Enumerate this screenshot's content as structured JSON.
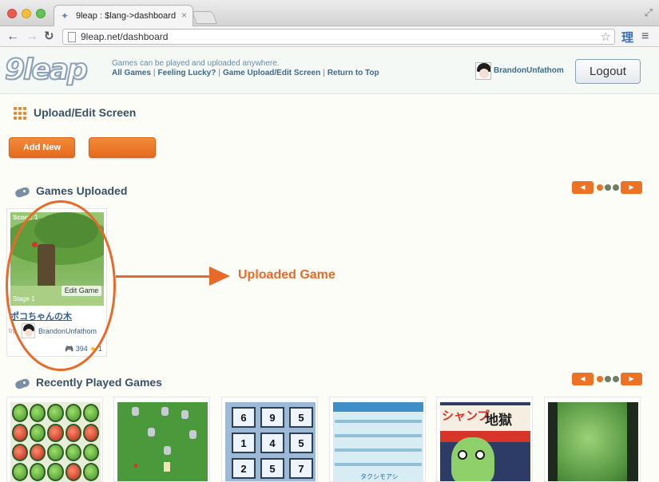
{
  "browser": {
    "tab_title": "9leap : $lang->dashboard",
    "tab_close": "×",
    "url": "9leap.net/dashboard",
    "extension_glyph": "理",
    "fullscreen_glyph": "⤢"
  },
  "header": {
    "logo_text": "9leap",
    "tagline": "Games can be played and uploaded anywhere.",
    "nav": {
      "all_games": "All Games",
      "feeling_lucky": "Feeling Lucky?",
      "upload_edit": "Game Upload/Edit Screen",
      "return_top": "Return to Top",
      "separator": "|"
    },
    "username": "BrandonUnfathom",
    "logout_label": "Logout"
  },
  "upload_section": {
    "title": "Upload/Edit Screen",
    "add_new_label": "Add New",
    "second_button_label": ""
  },
  "games_uploaded": {
    "title": "Games Uploaded",
    "pager": {
      "prev": "◀",
      "next": "▶"
    },
    "game": {
      "score_text": "Score: 1",
      "stage_text": "Stage 1",
      "edit_label": "Edit Game",
      "title": "ポコちゃんの木",
      "by_label": "by",
      "author": "BrandonUnfathom",
      "plays": "394",
      "stars": "1"
    }
  },
  "annotation": {
    "label": "Uploaded Game",
    "color": "#e86a2b"
  },
  "recently_played": {
    "title": "Recently Played Games",
    "pager": {
      "prev": "◀",
      "next": "▶"
    },
    "puzzle_numbers": [
      "6",
      "9",
      "5",
      "1",
      "4",
      "5",
      "2",
      "5",
      "7"
    ],
    "jump_title_kana": "シャンプ",
    "jump_title_kanji": "地獄",
    "game4_caption": "タクシモアシ"
  },
  "colors": {
    "accent_orange": "#ec7325",
    "link_blue": "#2f5f8a",
    "header_bg": "#f5f9f5"
  }
}
